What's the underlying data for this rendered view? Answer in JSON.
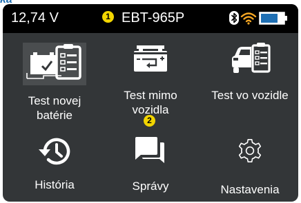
{
  "caption": "ka",
  "statusbar": {
    "voltage": "12,74 V",
    "step_badge": "1",
    "model": "EBT-965P",
    "icons": [
      "bluetooth-icon",
      "wifi-icon",
      "battery-icon"
    ],
    "battery_level": 0.75
  },
  "menu": {
    "items": [
      {
        "label": "Test novej batérie",
        "icon": "new-battery-checklist-icon"
      },
      {
        "label": "Test mimo vozidla",
        "icon": "battery-out-of-vehicle-icon"
      },
      {
        "label": "Test vo vozidle",
        "icon": "car-checklist-icon"
      },
      {
        "label": "História",
        "icon": "history-icon"
      },
      {
        "label": "Správy",
        "icon": "messages-icon"
      },
      {
        "label": "Nastavenia",
        "icon": "gear-icon"
      }
    ],
    "step_badge": "2"
  },
  "colors": {
    "status_bg": "#000000",
    "screen_bg": "#333638",
    "accent_blue": "#1f6fb3",
    "badge_yellow": "#f2d500",
    "wifi_orange": "#f5a623"
  }
}
